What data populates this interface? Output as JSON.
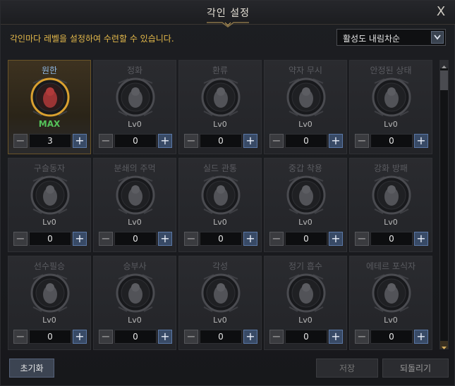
{
  "window": {
    "title": "각인 설정",
    "close_glyph": "X"
  },
  "description": "각인마다 레벨을 설정하여 수련할 수 있습니다.",
  "sort": {
    "selected": "활성도 내림차순"
  },
  "engravings": [
    {
      "name": "원한",
      "level": "MAX",
      "value": "3",
      "active": true,
      "icon": "grudge-icon"
    },
    {
      "name": "정화",
      "level": "Lv0",
      "value": "0",
      "active": false,
      "icon": "purify-icon"
    },
    {
      "name": "환류",
      "level": "Lv0",
      "value": "0",
      "active": false,
      "icon": "reflux-icon"
    },
    {
      "name": "약자 무시",
      "level": "Lv0",
      "value": "0",
      "active": false,
      "icon": "ignore-weak-icon"
    },
    {
      "name": "안정된 상태",
      "level": "Lv0",
      "value": "0",
      "active": false,
      "icon": "stable-state-icon"
    },
    {
      "name": "구슬동자",
      "level": "Lv0",
      "value": "0",
      "active": false,
      "icon": "orb-boy-icon"
    },
    {
      "name": "분쇄의 주먹",
      "level": "Lv0",
      "value": "0",
      "active": false,
      "icon": "crushing-fist-icon"
    },
    {
      "name": "실드 관통",
      "level": "Lv0",
      "value": "0",
      "active": false,
      "icon": "shield-pierce-icon"
    },
    {
      "name": "중갑 착용",
      "level": "Lv0",
      "value": "0",
      "active": false,
      "icon": "heavy-armor-icon"
    },
    {
      "name": "강화 방패",
      "level": "Lv0",
      "value": "0",
      "active": false,
      "icon": "reinforced-shield-icon"
    },
    {
      "name": "선수필승",
      "level": "Lv0",
      "value": "0",
      "active": false,
      "icon": "first-strike-icon"
    },
    {
      "name": "승부사",
      "level": "Lv0",
      "value": "0",
      "active": false,
      "icon": "gambler-icon"
    },
    {
      "name": "각성",
      "level": "Lv0",
      "value": "0",
      "active": false,
      "icon": "awakening-icon"
    },
    {
      "name": "정기 흡수",
      "level": "Lv0",
      "value": "0",
      "active": false,
      "icon": "spirit-absorb-icon"
    },
    {
      "name": "에테르 포식자",
      "level": "Lv0",
      "value": "0",
      "active": false,
      "icon": "ether-predator-icon"
    }
  ],
  "stepper": {
    "minus": "−",
    "plus": "+"
  },
  "buttons": {
    "reset": "초기화",
    "save": "저장",
    "revert": "되돌리기"
  }
}
